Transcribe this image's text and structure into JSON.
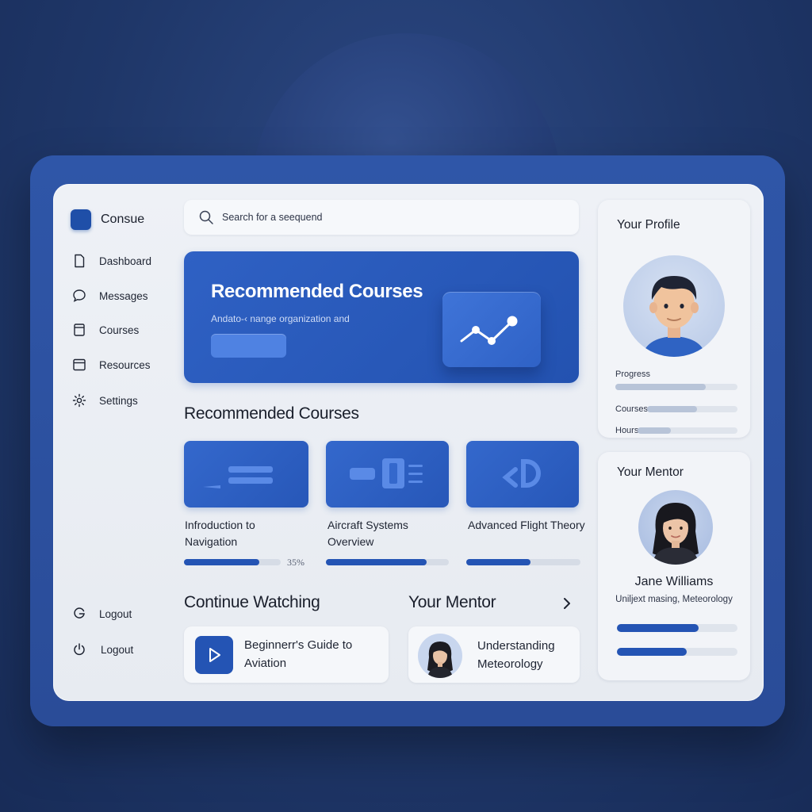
{
  "app": {
    "brand": "Consue"
  },
  "sidebar": {
    "items": [
      {
        "label": "Dashboard",
        "icon": "document-icon"
      },
      {
        "label": "Messages",
        "icon": "chat-bubble-icon"
      },
      {
        "label": "Courses",
        "icon": "book-icon"
      },
      {
        "label": "Resources",
        "icon": "folder-icon"
      },
      {
        "label": "Settings",
        "icon": "gear-icon"
      }
    ],
    "bottom_items": [
      {
        "label": "Logout",
        "icon": "g-logo-icon"
      },
      {
        "label": "Logout",
        "icon": "power-icon"
      }
    ]
  },
  "search": {
    "placeholder": "Search for a seequend"
  },
  "hero": {
    "title": "Recommended Courses",
    "subtitle": "Andato-‹ nange organization and",
    "icon": "line-chart-icon"
  },
  "courses_section": {
    "title": "Recommended Courses",
    "courses": [
      {
        "title": "Infroduction to Navigation",
        "progress": 0.78,
        "progress_label": "35%"
      },
      {
        "title": "Aircraft Systems Overview",
        "progress": 0.82
      },
      {
        "title": "Advanced Flight Theory",
        "progress": 0.56
      }
    ]
  },
  "continue": {
    "title": "Continue Watching",
    "item": "Beginnerr's Guide to Aviation"
  },
  "mentor_section": {
    "title": "Your Mentor",
    "item": "Understanding Meteorology"
  },
  "profile": {
    "title": "Your Profile",
    "stats": [
      {
        "label": "Progress",
        "value": 0.74
      },
      {
        "label": "Courses",
        "value": 0.55
      },
      {
        "label": "Hours",
        "value": 0.33
      }
    ]
  },
  "mentor": {
    "title": "Your Mentor",
    "name": "Jane Williams",
    "subtitle": "Uniljext masing, Meteorology",
    "bars": [
      0.68,
      0.58
    ]
  },
  "colors": {
    "accent": "#2454b4",
    "bg": "#1f3769",
    "panel": "#eef1f6"
  }
}
